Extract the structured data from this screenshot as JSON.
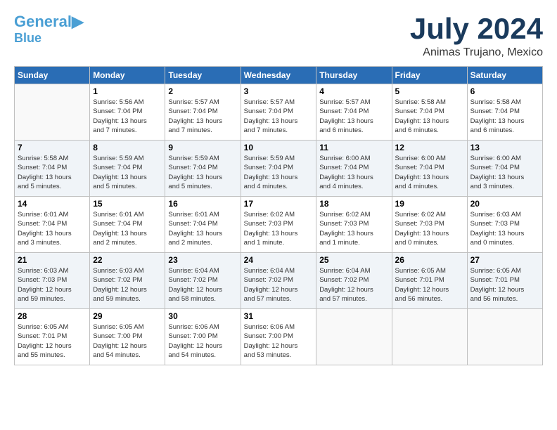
{
  "header": {
    "logo": {
      "line1": "General",
      "line2": "Blue"
    },
    "title": "July 2024",
    "location": "Animas Trujano, Mexico"
  },
  "days_of_week": [
    "Sunday",
    "Monday",
    "Tuesday",
    "Wednesday",
    "Thursday",
    "Friday",
    "Saturday"
  ],
  "weeks": [
    [
      {
        "day": "",
        "info": ""
      },
      {
        "day": "1",
        "info": "Sunrise: 5:56 AM\nSunset: 7:04 PM\nDaylight: 13 hours\nand 7 minutes."
      },
      {
        "day": "2",
        "info": "Sunrise: 5:57 AM\nSunset: 7:04 PM\nDaylight: 13 hours\nand 7 minutes."
      },
      {
        "day": "3",
        "info": "Sunrise: 5:57 AM\nSunset: 7:04 PM\nDaylight: 13 hours\nand 7 minutes."
      },
      {
        "day": "4",
        "info": "Sunrise: 5:57 AM\nSunset: 7:04 PM\nDaylight: 13 hours\nand 6 minutes."
      },
      {
        "day": "5",
        "info": "Sunrise: 5:58 AM\nSunset: 7:04 PM\nDaylight: 13 hours\nand 6 minutes."
      },
      {
        "day": "6",
        "info": "Sunrise: 5:58 AM\nSunset: 7:04 PM\nDaylight: 13 hours\nand 6 minutes."
      }
    ],
    [
      {
        "day": "7",
        "info": "Sunrise: 5:58 AM\nSunset: 7:04 PM\nDaylight: 13 hours\nand 5 minutes."
      },
      {
        "day": "8",
        "info": "Sunrise: 5:59 AM\nSunset: 7:04 PM\nDaylight: 13 hours\nand 5 minutes."
      },
      {
        "day": "9",
        "info": "Sunrise: 5:59 AM\nSunset: 7:04 PM\nDaylight: 13 hours\nand 5 minutes."
      },
      {
        "day": "10",
        "info": "Sunrise: 5:59 AM\nSunset: 7:04 PM\nDaylight: 13 hours\nand 4 minutes."
      },
      {
        "day": "11",
        "info": "Sunrise: 6:00 AM\nSunset: 7:04 PM\nDaylight: 13 hours\nand 4 minutes."
      },
      {
        "day": "12",
        "info": "Sunrise: 6:00 AM\nSunset: 7:04 PM\nDaylight: 13 hours\nand 4 minutes."
      },
      {
        "day": "13",
        "info": "Sunrise: 6:00 AM\nSunset: 7:04 PM\nDaylight: 13 hours\nand 3 minutes."
      }
    ],
    [
      {
        "day": "14",
        "info": "Sunrise: 6:01 AM\nSunset: 7:04 PM\nDaylight: 13 hours\nand 3 minutes."
      },
      {
        "day": "15",
        "info": "Sunrise: 6:01 AM\nSunset: 7:04 PM\nDaylight: 13 hours\nand 2 minutes."
      },
      {
        "day": "16",
        "info": "Sunrise: 6:01 AM\nSunset: 7:04 PM\nDaylight: 13 hours\nand 2 minutes."
      },
      {
        "day": "17",
        "info": "Sunrise: 6:02 AM\nSunset: 7:03 PM\nDaylight: 13 hours\nand 1 minute."
      },
      {
        "day": "18",
        "info": "Sunrise: 6:02 AM\nSunset: 7:03 PM\nDaylight: 13 hours\nand 1 minute."
      },
      {
        "day": "19",
        "info": "Sunrise: 6:02 AM\nSunset: 7:03 PM\nDaylight: 13 hours\nand 0 minutes."
      },
      {
        "day": "20",
        "info": "Sunrise: 6:03 AM\nSunset: 7:03 PM\nDaylight: 13 hours\nand 0 minutes."
      }
    ],
    [
      {
        "day": "21",
        "info": "Sunrise: 6:03 AM\nSunset: 7:03 PM\nDaylight: 12 hours\nand 59 minutes."
      },
      {
        "day": "22",
        "info": "Sunrise: 6:03 AM\nSunset: 7:02 PM\nDaylight: 12 hours\nand 59 minutes."
      },
      {
        "day": "23",
        "info": "Sunrise: 6:04 AM\nSunset: 7:02 PM\nDaylight: 12 hours\nand 58 minutes."
      },
      {
        "day": "24",
        "info": "Sunrise: 6:04 AM\nSunset: 7:02 PM\nDaylight: 12 hours\nand 57 minutes."
      },
      {
        "day": "25",
        "info": "Sunrise: 6:04 AM\nSunset: 7:02 PM\nDaylight: 12 hours\nand 57 minutes."
      },
      {
        "day": "26",
        "info": "Sunrise: 6:05 AM\nSunset: 7:01 PM\nDaylight: 12 hours\nand 56 minutes."
      },
      {
        "day": "27",
        "info": "Sunrise: 6:05 AM\nSunset: 7:01 PM\nDaylight: 12 hours\nand 56 minutes."
      }
    ],
    [
      {
        "day": "28",
        "info": "Sunrise: 6:05 AM\nSunset: 7:01 PM\nDaylight: 12 hours\nand 55 minutes."
      },
      {
        "day": "29",
        "info": "Sunrise: 6:05 AM\nSunset: 7:00 PM\nDaylight: 12 hours\nand 54 minutes."
      },
      {
        "day": "30",
        "info": "Sunrise: 6:06 AM\nSunset: 7:00 PM\nDaylight: 12 hours\nand 54 minutes."
      },
      {
        "day": "31",
        "info": "Sunrise: 6:06 AM\nSunset: 7:00 PM\nDaylight: 12 hours\nand 53 minutes."
      },
      {
        "day": "",
        "info": ""
      },
      {
        "day": "",
        "info": ""
      },
      {
        "day": "",
        "info": ""
      }
    ]
  ]
}
